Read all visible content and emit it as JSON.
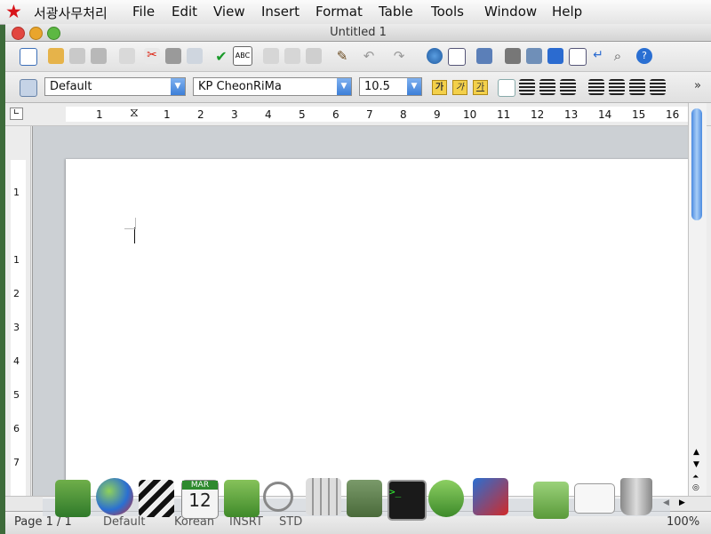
{
  "menubar": {
    "app_name": "서광사무처리",
    "items": [
      "File",
      "Edit",
      "View",
      "Insert",
      "Format",
      "Table",
      "Tools",
      "Window",
      "Help"
    ]
  },
  "window": {
    "title": "Untitled 1"
  },
  "toolbar2": {
    "paragraph_style": "Default",
    "font_name": "KP CheonRiMa",
    "font_size": "10.5"
  },
  "ruler": {
    "h_numbers": [
      "1",
      "1",
      "2",
      "3",
      "4",
      "5",
      "6",
      "7",
      "8",
      "9",
      "10",
      "11",
      "12",
      "13",
      "14",
      "15",
      "16"
    ],
    "v_numbers": [
      "1",
      "1",
      "2",
      "3",
      "4",
      "5",
      "6",
      "7"
    ]
  },
  "statusbar": {
    "page": "Page 1 / 1",
    "style": "Default",
    "language": "Korean",
    "mode": "INSRT",
    "selection": "STD",
    "zoom": "100%"
  },
  "dock": {
    "items": [
      "bookmark-app-icon",
      "globe-icon",
      "movie-clapper-icon",
      "calendar-icon",
      "address-book-icon",
      "magnifier-icon",
      "calculator-icon",
      "system-preferences-icon",
      "terminal-icon",
      "help-network-icon",
      "office-app-icon",
      "folder-icon",
      "mail-icon",
      "trash-icon"
    ],
    "calendar_month": "MAR",
    "calendar_day": "12"
  },
  "colors": {
    "accent": "#3d7fd8",
    "star": "#d8141a"
  }
}
